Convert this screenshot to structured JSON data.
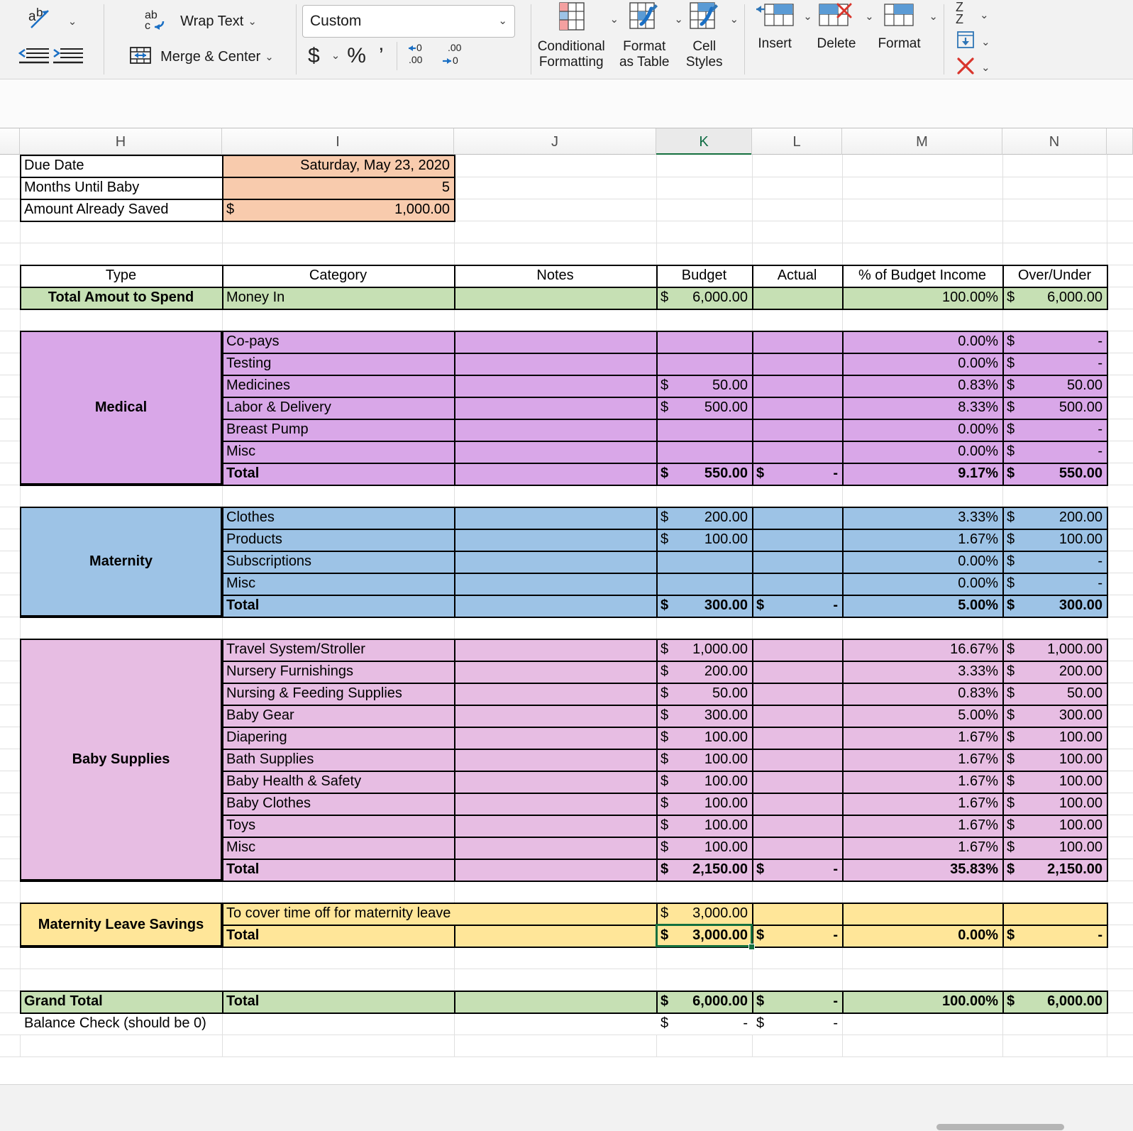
{
  "ribbon": {
    "groups": {
      "alignment": {
        "orientation_icon": "text-orientation-icon",
        "decrease_indent": "decrease-indent-icon",
        "increase_indent": "increase-indent-icon"
      },
      "wrap": {
        "wrap_text_label": "Wrap Text",
        "merge_center_label": "Merge & Center"
      },
      "number": {
        "format_value": "Custom",
        "currency_label": "$",
        "percent_label": "%",
        "comma_label": "’",
        "decrease_decimal": ".00",
        "increase_decimal": ".00"
      },
      "styles": {
        "conditional_formatting": "Conditional\nFormatting",
        "conditional_formatting_l1": "Conditional",
        "conditional_formatting_l2": "Formatting",
        "format_as_table_l1": "Format",
        "format_as_table_l2": "as Table",
        "cell_styles_l1": "Cell",
        "cell_styles_l2": "Styles"
      },
      "cells": {
        "insert": "Insert",
        "delete": "Delete",
        "format": "Format"
      },
      "editing": {
        "sort_icon": "sort-az-icon",
        "fill_icon": "fill-down-icon",
        "clear_icon": "clear-icon"
      }
    }
  },
  "sheet": {
    "columns": [
      "H",
      "I",
      "J",
      "K",
      "L",
      "M",
      "N"
    ],
    "selected_column": "K",
    "selected_cell_value": "3,000.00",
    "info_rows": [
      {
        "label": "Due Date",
        "value": "Saturday, May 23, 2020",
        "symbol": ""
      },
      {
        "label": "Months Until Baby",
        "value": "5",
        "symbol": ""
      },
      {
        "label": "Amount Already Saved",
        "value": "1,000.00",
        "symbol": "$"
      }
    ],
    "table_headers": {
      "type": "Type",
      "category": "Category",
      "notes": "Notes",
      "budget": "Budget",
      "actual": "Actual",
      "pct": "% of Budget Income",
      "over_under": "Over/Under"
    },
    "income_row": {
      "type": "Total Amout to Spend",
      "category": "Money In",
      "notes": "",
      "budget_sym": "$",
      "budget": "6,000.00",
      "actual_sym": "",
      "actual": "",
      "pct": "100.00%",
      "ou_sym": "$",
      "over_under": "6,000.00"
    },
    "sections": [
      {
        "name": "Medical",
        "color": "#D9A7E8",
        "rows": [
          {
            "category": "Co-pays",
            "notes": "",
            "budget_sym": "",
            "budget": "",
            "actual_sym": "",
            "actual": "",
            "pct": "0.00%",
            "ou_sym": "$",
            "over_under": "-"
          },
          {
            "category": "Testing",
            "notes": "",
            "budget_sym": "",
            "budget": "",
            "actual_sym": "",
            "actual": "",
            "pct": "0.00%",
            "ou_sym": "$",
            "over_under": "-"
          },
          {
            "category": "Medicines",
            "notes": "",
            "budget_sym": "$",
            "budget": "50.00",
            "actual_sym": "",
            "actual": "",
            "pct": "0.83%",
            "ou_sym": "$",
            "over_under": "50.00"
          },
          {
            "category": "Labor & Delivery",
            "notes": "",
            "budget_sym": "$",
            "budget": "500.00",
            "actual_sym": "",
            "actual": "",
            "pct": "8.33%",
            "ou_sym": "$",
            "over_under": "500.00"
          },
          {
            "category": "Breast Pump",
            "notes": "",
            "budget_sym": "",
            "budget": "",
            "actual_sym": "",
            "actual": "",
            "pct": "0.00%",
            "ou_sym": "$",
            "over_under": "-"
          },
          {
            "category": "Misc",
            "notes": "",
            "budget_sym": "",
            "budget": "",
            "actual_sym": "",
            "actual": "",
            "pct": "0.00%",
            "ou_sym": "$",
            "over_under": "-"
          },
          {
            "category": "Total",
            "total": true,
            "notes": "",
            "budget_sym": "$",
            "budget": "550.00",
            "actual_sym": "$",
            "actual": "-",
            "pct": "9.17%",
            "ou_sym": "$",
            "over_under": "550.00"
          }
        ]
      },
      {
        "name": "Maternity",
        "color": "#9DC3E6",
        "rows": [
          {
            "category": "Clothes",
            "notes": "",
            "budget_sym": "$",
            "budget": "200.00",
            "actual_sym": "",
            "actual": "",
            "pct": "3.33%",
            "ou_sym": "$",
            "over_under": "200.00"
          },
          {
            "category": "Products",
            "notes": "",
            "budget_sym": "$",
            "budget": "100.00",
            "actual_sym": "",
            "actual": "",
            "pct": "1.67%",
            "ou_sym": "$",
            "over_under": "100.00"
          },
          {
            "category": "Subscriptions",
            "notes": "",
            "budget_sym": "",
            "budget": "",
            "actual_sym": "",
            "actual": "",
            "pct": "0.00%",
            "ou_sym": "$",
            "over_under": "-"
          },
          {
            "category": "Misc",
            "notes": "",
            "budget_sym": "",
            "budget": "",
            "actual_sym": "",
            "actual": "",
            "pct": "0.00%",
            "ou_sym": "$",
            "over_under": "-"
          },
          {
            "category": "Total",
            "total": true,
            "notes": "",
            "budget_sym": "$",
            "budget": "300.00",
            "actual_sym": "$",
            "actual": "-",
            "pct": "5.00%",
            "ou_sym": "$",
            "over_under": "300.00"
          }
        ]
      },
      {
        "name": "Baby Supplies",
        "color": "#E7BDE3",
        "rows": [
          {
            "category": "Travel System/Stroller",
            "notes": "",
            "budget_sym": "$",
            "budget": "1,000.00",
            "actual_sym": "",
            "actual": "",
            "pct": "16.67%",
            "ou_sym": "$",
            "over_under": "1,000.00"
          },
          {
            "category": "Nursery Furnishings",
            "notes": "",
            "budget_sym": "$",
            "budget": "200.00",
            "actual_sym": "",
            "actual": "",
            "pct": "3.33%",
            "ou_sym": "$",
            "over_under": "200.00"
          },
          {
            "category": "Nursing & Feeding Supplies",
            "notes": "",
            "budget_sym": "$",
            "budget": "50.00",
            "actual_sym": "",
            "actual": "",
            "pct": "0.83%",
            "ou_sym": "$",
            "over_under": "50.00"
          },
          {
            "category": "Baby Gear",
            "notes": "",
            "budget_sym": "$",
            "budget": "300.00",
            "actual_sym": "",
            "actual": "",
            "pct": "5.00%",
            "ou_sym": "$",
            "over_under": "300.00"
          },
          {
            "category": "Diapering",
            "notes": "",
            "budget_sym": "$",
            "budget": "100.00",
            "actual_sym": "",
            "actual": "",
            "pct": "1.67%",
            "ou_sym": "$",
            "over_under": "100.00"
          },
          {
            "category": "Bath Supplies",
            "notes": "",
            "budget_sym": "$",
            "budget": "100.00",
            "actual_sym": "",
            "actual": "",
            "pct": "1.67%",
            "ou_sym": "$",
            "over_under": "100.00"
          },
          {
            "category": "Baby Health & Safety",
            "notes": "",
            "budget_sym": "$",
            "budget": "100.00",
            "actual_sym": "",
            "actual": "",
            "pct": "1.67%",
            "ou_sym": "$",
            "over_under": "100.00"
          },
          {
            "category": "Baby Clothes",
            "notes": "",
            "budget_sym": "$",
            "budget": "100.00",
            "actual_sym": "",
            "actual": "",
            "pct": "1.67%",
            "ou_sym": "$",
            "over_under": "100.00"
          },
          {
            "category": "Toys",
            "notes": "",
            "budget_sym": "$",
            "budget": "100.00",
            "actual_sym": "",
            "actual": "",
            "pct": "1.67%",
            "ou_sym": "$",
            "over_under": "100.00"
          },
          {
            "category": "Misc",
            "notes": "",
            "budget_sym": "$",
            "budget": "100.00",
            "actual_sym": "",
            "actual": "",
            "pct": "1.67%",
            "ou_sym": "$",
            "over_under": "100.00"
          },
          {
            "category": "Total",
            "total": true,
            "notes": "",
            "budget_sym": "$",
            "budget": "2,150.00",
            "actual_sym": "$",
            "actual": "-",
            "pct": "35.83%",
            "ou_sym": "$",
            "over_under": "2,150.00"
          }
        ]
      },
      {
        "name": "Maternity Leave Savings",
        "color": "#FFE699",
        "rows": [
          {
            "category": "To cover time off for maternity leave",
            "spans_notes": true,
            "notes": "",
            "budget_sym": "$",
            "budget": "3,000.00",
            "actual_sym": "",
            "actual": "",
            "pct": "",
            "ou_sym": "",
            "over_under": ""
          },
          {
            "category": "Total",
            "total": true,
            "notes": "",
            "budget_sym": "$",
            "budget": "3,000.00",
            "actual_sym": "$",
            "actual": "-",
            "pct": "0.00%",
            "ou_sym": "$",
            "over_under": "-"
          }
        ]
      }
    ],
    "grand_total": {
      "type": "Grand Total",
      "category": "Total",
      "notes": "",
      "budget_sym": "$",
      "budget": "6,000.00",
      "actual_sym": "$",
      "actual": "-",
      "pct": "100.00%",
      "ou_sym": "$",
      "over_under": "6,000.00"
    },
    "balance_check": {
      "label": "Balance Check (should be 0)",
      "budget_sym": "$",
      "budget": "-",
      "actual_sym": "$",
      "actual": "-"
    },
    "colors": {
      "income_green": "#C6E0B4",
      "orange": "#F8CBAD",
      "medical_purple": "#D9A7E8",
      "maternity_blue": "#9DC3E6",
      "baby_pink": "#E7BDE3",
      "savings_yellow": "#FFE699",
      "selection_green": "#14703F"
    }
  }
}
